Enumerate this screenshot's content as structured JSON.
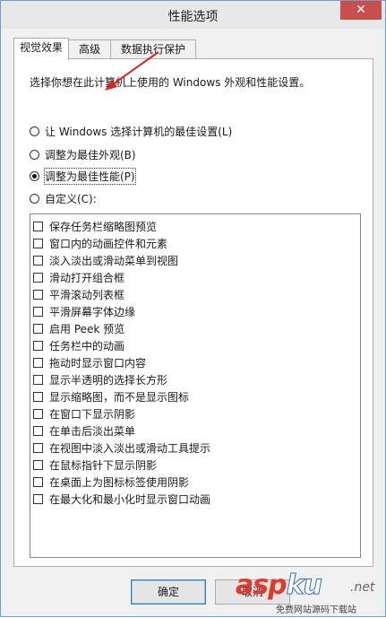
{
  "window": {
    "title": "性能选项",
    "close_glyph": "✕"
  },
  "tabs": [
    {
      "label": "视觉效果",
      "active": true
    },
    {
      "label": "高级",
      "active": false
    },
    {
      "label": "数据执行保护",
      "active": false
    }
  ],
  "description": "选择你想在此计算机上使用的 Windows 外观和性能设置。",
  "options": [
    {
      "label": "让 Windows 选择计算机的最佳设置(L)",
      "checked": false
    },
    {
      "label": "调整为最佳外观(B)",
      "checked": false
    },
    {
      "label": "调整为最佳性能(P)",
      "checked": true
    },
    {
      "label": "自定义(C):",
      "checked": false
    }
  ],
  "effects": [
    "保存任务栏缩略图预览",
    "窗口内的动画控件和元素",
    "淡入淡出或滑动菜单到视图",
    "滑动打开组合框",
    "平滑滚动列表框",
    "平滑屏幕字体边缘",
    "启用 Peek 预览",
    "任务栏中的动画",
    "拖动时显示窗口内容",
    "显示半透明的选择长方形",
    "显示缩略图，而不是显示图标",
    "在窗口下显示阴影",
    "在单击后淡出菜单",
    "在视图中淡入淡出或滑动工具提示",
    "在鼠标指针下显示阴影",
    "在桌面上为图标标签使用阴影",
    "在最大化和最小化时显示窗口动画"
  ],
  "buttons": {
    "ok": "确定",
    "cancel": "取消"
  },
  "watermark": {
    "brand_a": "asp",
    "brand_b": "ku",
    "suffix": ".net",
    "sub": "免费网站源码下载站"
  },
  "colors": {
    "close": "#c7504a",
    "arrow": "#d9261c",
    "watermark_red": "#e23a2a"
  }
}
